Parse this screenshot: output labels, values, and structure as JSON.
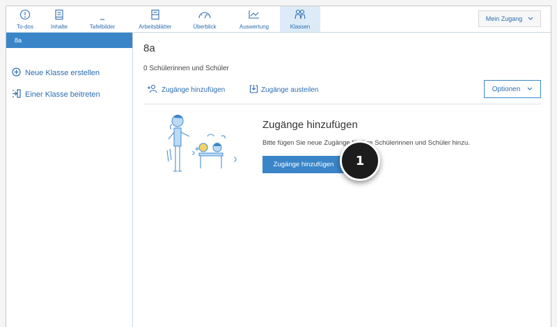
{
  "nav": {
    "items": [
      {
        "label": "To-dos",
        "icon": "todo-icon"
      },
      {
        "label": "Inhalte",
        "icon": "contents-icon"
      },
      {
        "label": "Tafelbilder",
        "icon": "board-icon"
      },
      {
        "label": "Arbeitsblätter",
        "icon": "worksheet-icon"
      },
      {
        "label": "Überblick",
        "icon": "gauge-icon"
      },
      {
        "label": "Auswertung",
        "icon": "chart-icon"
      },
      {
        "label": "Klassen",
        "icon": "class-icon",
        "active": true
      }
    ],
    "account_label": "Mein Zugang"
  },
  "sidebar": {
    "selected_class": "8a",
    "create_label": "Neue Klasse erstellen",
    "join_label": "Einer Klasse beitreten"
  },
  "main": {
    "class_title": "8a",
    "student_count_text": "0 Schülerinnen und Schüler",
    "add_access_label": "Zugänge hinzufügen",
    "distribute_access_label": "Zugänge austeilen",
    "options_label": "Optionen",
    "panel": {
      "title": "Zugänge hinzufügen",
      "text": "Bitte fügen Sie neue Zugänge für Ihre Schülerinnen und Schüler hinzu.",
      "button_label": "Zugänge hinzufügen"
    }
  },
  "step_badge": "1",
  "colors": {
    "accent": "#3a85c8",
    "link": "#2b6cb0",
    "active_nav": "#dcebf7",
    "badge": "#1c1c1c"
  }
}
